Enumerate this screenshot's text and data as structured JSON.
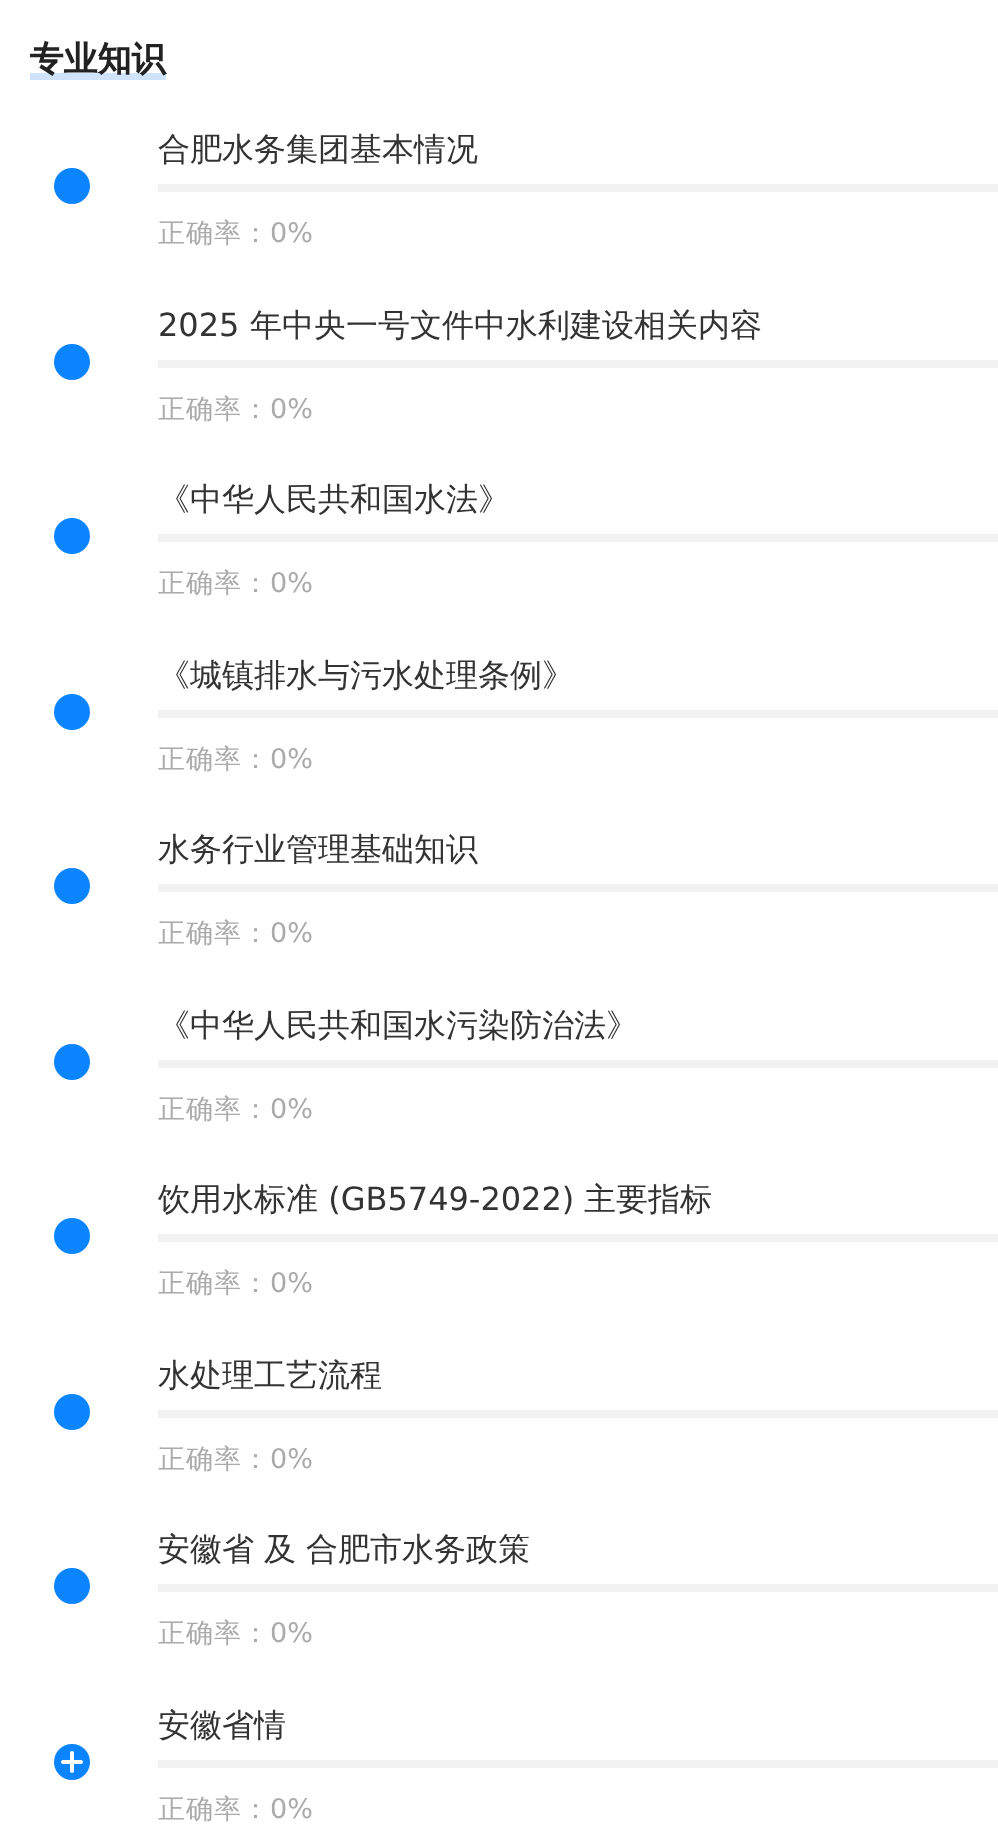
{
  "section_title": "专业知识",
  "topics": [
    {
      "title": "合肥水务集团基本情况",
      "level": 0,
      "accuracy": "正确率：0%",
      "kind": "dot"
    },
    {
      "title": "2025 年中央一号文件中水利建设相关内容",
      "level": 0,
      "accuracy": "正确率：0%",
      "kind": "dot"
    },
    {
      "title": "《中华人民共和国水法》",
      "level": 0,
      "accuracy": "正确率：0%",
      "kind": "dot"
    },
    {
      "title": "《城镇排水与污水处理条例》",
      "level": 0,
      "accuracy": "正确率：0%",
      "kind": "dot"
    },
    {
      "title": "水务行业管理基础知识",
      "level": 0,
      "accuracy": "正确率：0%",
      "kind": "dot"
    },
    {
      "title": "《中华人民共和国水污染防治法》",
      "level": 0,
      "accuracy": "正确率：0%",
      "kind": "dot"
    },
    {
      "title": "饮用水标准 (GB5749-2022) 主要指标",
      "level": 0,
      "accuracy": "正确率：0%",
      "kind": "dot"
    },
    {
      "title": "水处理工艺流程",
      "level": 0,
      "accuracy": "正确率：0%",
      "kind": "dot"
    },
    {
      "title": "安徽省 及 合肥市水务政策",
      "level": 0,
      "accuracy": "正确率：0%",
      "kind": "dot"
    },
    {
      "title": "安徽省情",
      "level": 0,
      "accuracy": "正确率：0%",
      "kind": "plus"
    }
  ]
}
